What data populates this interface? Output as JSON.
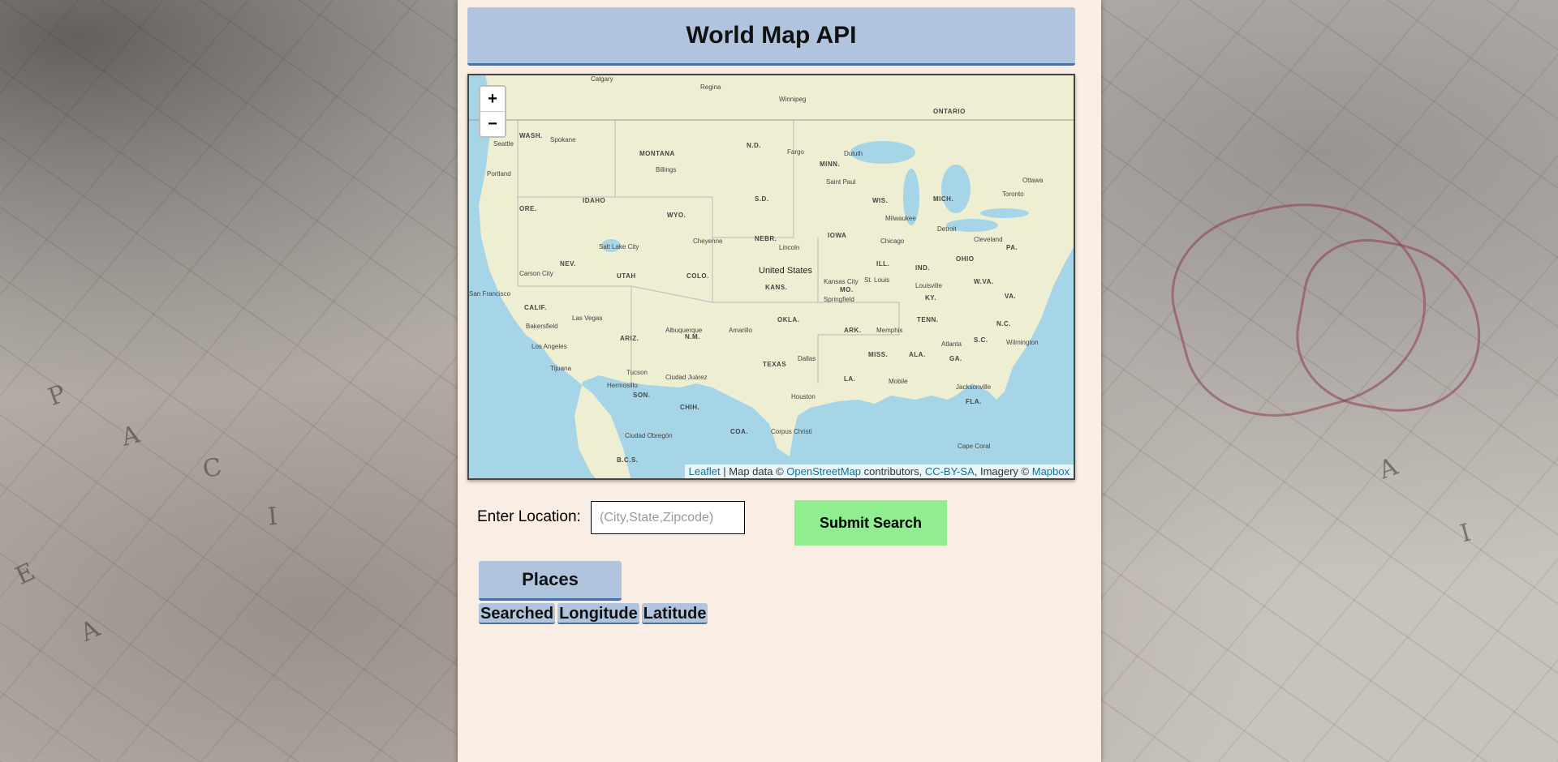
{
  "page": {
    "title": "World Map API"
  },
  "map": {
    "zoom_in": "+",
    "zoom_out": "−",
    "attribution": {
      "leaflet": "Leaflet",
      "map_data": " | Map data © ",
      "osm": "OpenStreetMap",
      "contributors": " contributors, ",
      "license": "CC-BY-SA",
      "imagery": ", Imagery © ",
      "mapbox": "Mapbox"
    },
    "labels": {
      "country": "United States",
      "ontario": "ONTARIO",
      "wash": "WASH.",
      "montana": "MONTANA",
      "nd": "N.D.",
      "minn": "MINN.",
      "idaho": "IDAHO",
      "ore": "ORE.",
      "wyo": "WYO.",
      "sd": "S.D.",
      "wis": "WIS.",
      "mich": "MICH.",
      "iowa": "IOWA",
      "nebr": "NEBR.",
      "nev": "NEV.",
      "utah": "UTAH",
      "colo": "COLO.",
      "kans": "KANS.",
      "ill": "ILL.",
      "ind": "IND.",
      "ohio": "OHIO",
      "pa": "PA.",
      "calif": "CALIF.",
      "mo": "MO.",
      "ky": "KY.",
      "wva": "W.VA.",
      "va": "VA.",
      "ariz": "ARIZ.",
      "nm": "N.M.",
      "okla": "OKLA.",
      "tenn": "TENN.",
      "nc": "N.C.",
      "ark": "ARK.",
      "sc": "S.C.",
      "texas": "TEXAS",
      "miss": "MISS.",
      "ala": "ALA.",
      "ga": "GA.",
      "la": "LA.",
      "fla": "FLA.",
      "son": "SON.",
      "chih": "CHIH.",
      "coa": "COA.",
      "bcs": "B.C.S.",
      "calgary": "Calgary",
      "regina": "Regina",
      "winnipeg": "Winnipeg",
      "seattle": "Seattle",
      "portland": "Portland",
      "spokane": "Spokane",
      "billings": "Billings",
      "fargo": "Fargo",
      "duluth": "Duluth",
      "saint_paul": "Saint Paul",
      "milwaukee": "Milwaukee",
      "chicago": "Chicago",
      "detroit": "Detroit",
      "toronto": "Toronto",
      "ottawa": "Ottawa",
      "cleveland": "Cleveland",
      "cheyenne": "Cheyenne",
      "salt_lake_city": "Salt Lake City",
      "lincoln": "Lincoln",
      "kansas_city": "Kansas City",
      "st_louis": "St. Louis",
      "louisville": "Louisville",
      "san_francisco": "San Francisco",
      "carson_city": "Carson City",
      "las_vegas": "Las Vegas",
      "bakersfield": "Bakersfield",
      "los_angeles": "Los Angeles",
      "tijuana": "Tijuana",
      "albuquerque": "Albuquerque",
      "amarillo": "Amarillo",
      "memphis": "Memphis",
      "atlanta": "Atlanta",
      "dallas": "Dallas",
      "houston": "Houston",
      "tucson": "Tucson",
      "ciudad_juarez": "Ciudad Juárez",
      "jacksonville": "Jacksonville",
      "corpus_christi": "Corpus Christi",
      "springfield": "Springfield",
      "mobile": "Mobile",
      "wilmington": "Wilmington",
      "cape_coral": "Cape Coral",
      "hermosillo": "Hermosillo",
      "ciudad_obregon": "Ciudad Obregón"
    }
  },
  "search": {
    "label": "Enter Location:",
    "placeholder": "(City,State,Zipcode)",
    "submit_label": "Submit Search"
  },
  "places": {
    "button_label": "Places",
    "columns": [
      "Searched",
      "Longitude",
      "Latitude"
    ]
  },
  "colors": {
    "header_bg": "#b0c4de",
    "panel_bg": "#faeee4",
    "submit_bg": "#90ee90",
    "water": "#a6d5e8",
    "land": "#eeeed2"
  }
}
